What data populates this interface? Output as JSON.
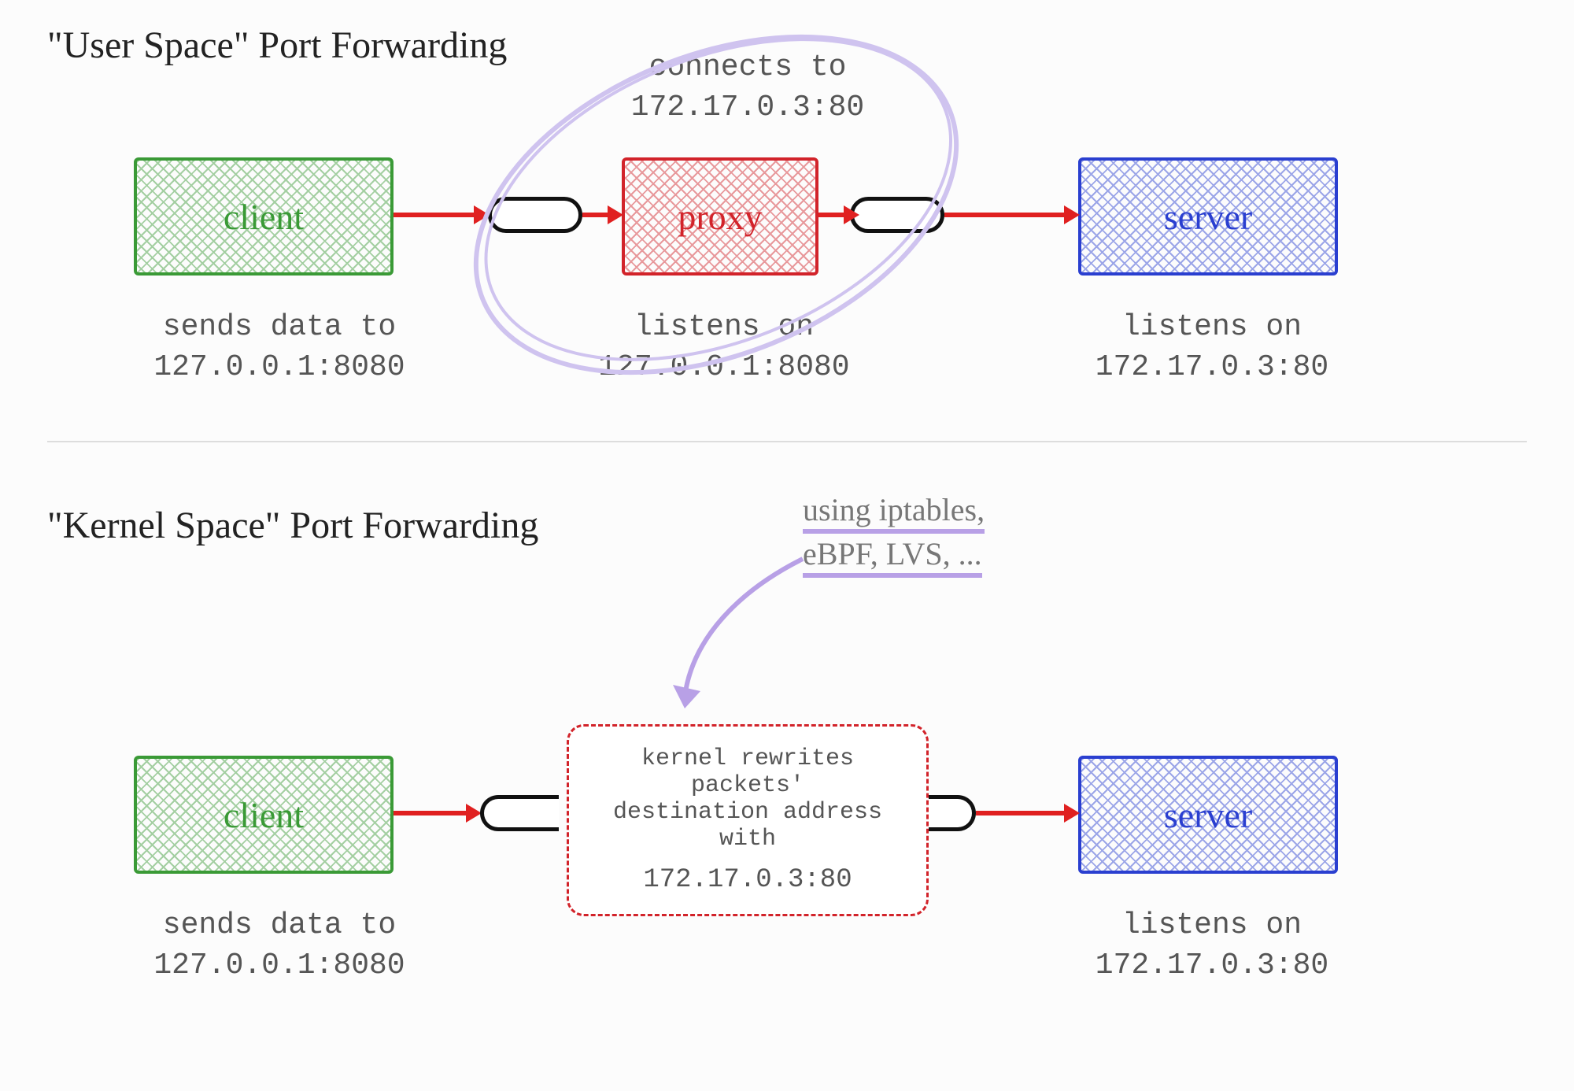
{
  "userspace": {
    "title": "\"User Space\" Port Forwarding",
    "client": {
      "label": "client",
      "caption1": "sends data to",
      "caption2": "127.0.0.1:8080"
    },
    "proxy": {
      "label": "proxy",
      "top1": "connects to",
      "top2": "172.17.0.3:80",
      "bot1": "listens on",
      "bot2": "127.0.0.1:8080"
    },
    "server": {
      "label": "server",
      "caption1": "listens on",
      "caption2": "172.17.0.3:80"
    }
  },
  "kernelspace": {
    "title": "\"Kernel Space\" Port Forwarding",
    "client": {
      "label": "client",
      "caption1": "sends data to",
      "caption2": "127.0.0.1:8080"
    },
    "kernel": {
      "line1": "kernel rewrites packets'",
      "line2": "destination address with",
      "line3": "172.17.0.3:80"
    },
    "server": {
      "label": "server",
      "caption1": "listens on",
      "caption2": "172.17.0.3:80"
    },
    "methods": {
      "line1": "using iptables,",
      "line2": "eBPF, LVS, ..."
    }
  }
}
